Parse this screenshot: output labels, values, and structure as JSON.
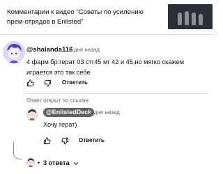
{
  "header": {
    "title": "Комментарии к видео \"Советы по усилению прем-отрядов в Enlisted\"",
    "thumbnail_icon": "video-thumbnail-soldiers"
  },
  "comment": {
    "author": "@shalanda116",
    "time": "2 дня назад",
    "text": "4 фарм бр:герат 03 стг45  мг 42 и 45,но мягко скажем играется это так себе",
    "reply_label": "Ответить",
    "like_icon": "thumbs-up-icon",
    "dislike_icon": "thumbs-down-icon"
  },
  "linked_notice": "Ответ открыт по ссылке",
  "reply": {
    "author": "@EnlistedDeck",
    "time": "2 дня назад",
    "text": "Хочу герат)",
    "reply_label": "Ответить"
  },
  "replies_toggle": {
    "bullet": "•",
    "label": "3 ответа",
    "icon": "chevron-down-icon"
  }
}
